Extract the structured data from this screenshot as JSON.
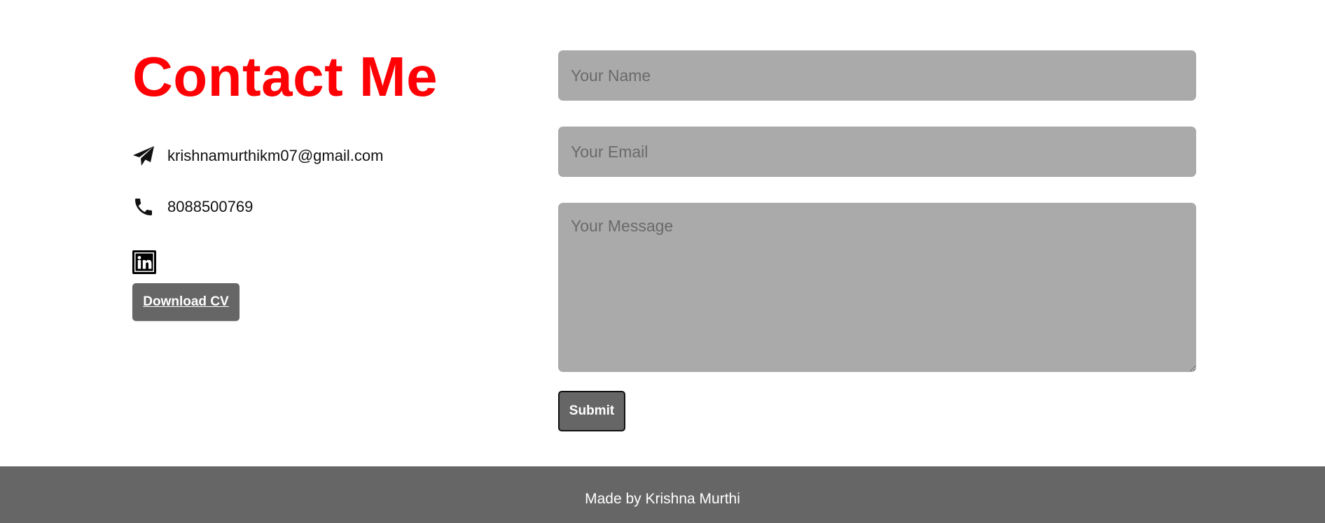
{
  "contact": {
    "title": "Contact Me",
    "email": "krishnamurthikm07@gmail.com",
    "phone": "8088500769",
    "download_cv_label": "Download CV"
  },
  "icons": {
    "email": "paper-plane-icon",
    "phone": "phone-icon",
    "linkedin": "linkedin-icon"
  },
  "form": {
    "name_placeholder": "Your Name",
    "email_placeholder": "Your Email",
    "message_placeholder": "Your Message",
    "submit_label": "Submit"
  },
  "footer": {
    "text": "Made by Krishna Murthi"
  },
  "colors": {
    "title": "#ff0004",
    "field_background": "#aaaaaa",
    "button_background": "#666666",
    "footer_background": "#666666"
  }
}
